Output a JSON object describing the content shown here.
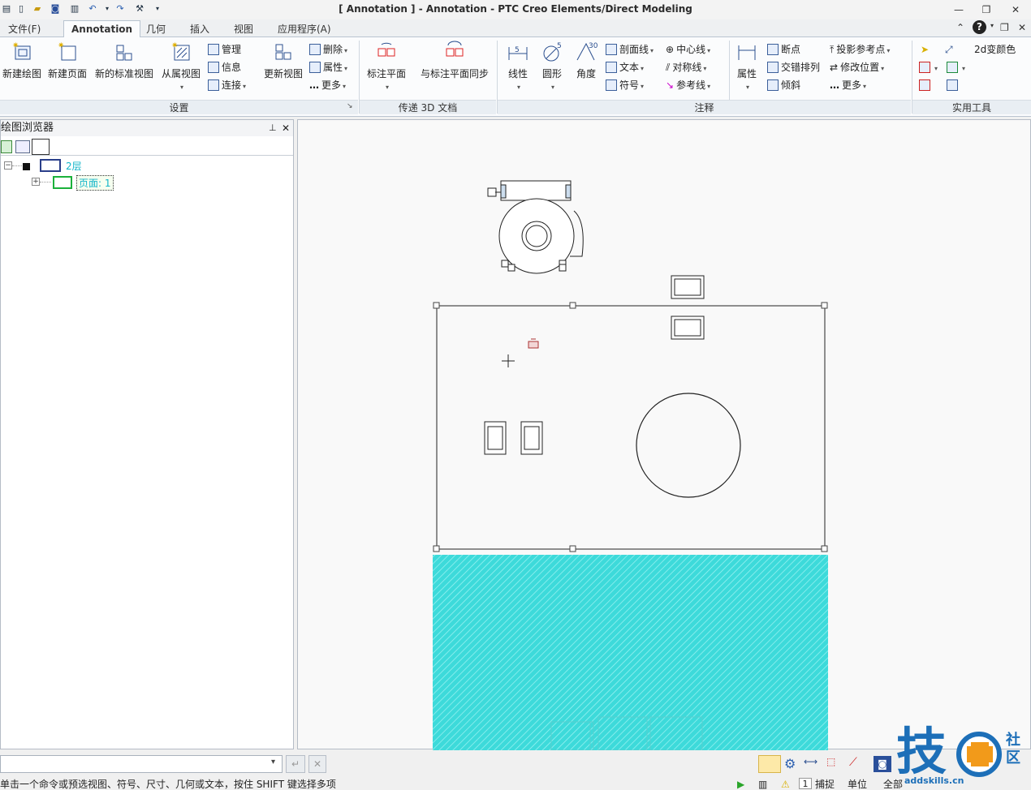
{
  "window": {
    "title": "[ Annotation ] - Annotation - PTC Creo Elements/Direct Modeling"
  },
  "tabs": [
    {
      "label": "文件(F)"
    },
    {
      "label": "Annotation"
    },
    {
      "label": "几何"
    },
    {
      "label": "插入"
    },
    {
      "label": "视图"
    },
    {
      "label": "应用程序(A)"
    }
  ],
  "ribbon": {
    "settings": {
      "label": "设置",
      "buttons": [
        "新建绘图",
        "新建页面",
        "新的标准视图",
        "从属视图",
        "更新视图"
      ],
      "small": [
        "管理",
        "信息",
        "连接",
        "删除",
        "属性",
        "更多"
      ]
    },
    "transfer": {
      "label": "传递 3D 文档",
      "buttons": [
        "标注平面",
        "与标注平面同步"
      ]
    },
    "annotate": {
      "label": "注释",
      "buttons": [
        "线性",
        "圆形",
        "角度",
        "属性"
      ],
      "small": [
        "剖面线",
        "文本",
        "符号",
        "中心线",
        "对称线",
        "参考线",
        "断点",
        "交错排列",
        "倾斜",
        "投影参考点",
        "修改位置",
        "更多"
      ],
      "icon_text": {
        "linear": "5",
        "circle": "5",
        "angle": "30"
      }
    },
    "utility": {
      "label": "实用工具",
      "small": [
        "2d变颜色"
      ]
    }
  },
  "browser": {
    "title": "绘图浏览器",
    "tree": [
      {
        "label": "2层"
      },
      {
        "label": "页面: 1"
      }
    ]
  },
  "status": {
    "text": "单击一个命令或预选视图、符号、尺寸、几何或文本，按住 SHIFT 键选择多项",
    "page_field": "1",
    "catch": "捕捉",
    "unit": "单位",
    "all": "全部"
  },
  "watermark": {
    "text": "技",
    "site": "addskills.cn",
    "badge": "社区"
  },
  "colors": {
    "hatch": "#38d9d9",
    "accent": "#1d6fb8",
    "tree_text": "#12b5c9"
  }
}
